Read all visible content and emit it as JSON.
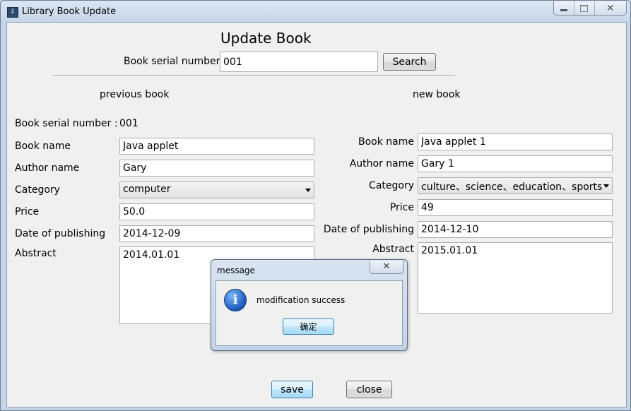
{
  "window": {
    "title": "Library Book Update",
    "app_icon": "book-app-icon",
    "controls": {
      "minimize": "minimize-icon",
      "maximize": "maximize-icon",
      "close": "✕"
    }
  },
  "header": {
    "title": "Update Book",
    "serial_label": "Book serial number",
    "serial_value": "001",
    "search_label": "Search"
  },
  "previous": {
    "heading": "previous book",
    "serial_label": "Book serial number :",
    "serial_value": "001",
    "name_label": "Book name",
    "name_value": "Java applet",
    "author_label": "Author name",
    "author_value": "Gary",
    "category_label": "Category",
    "category_value": "computer",
    "price_label": "Price",
    "price_value": "50.0",
    "date_label": "Date of publishing",
    "date_value": "2014-12-09",
    "abstract_label": "Abstract",
    "abstract_value": "2014.01.01"
  },
  "new": {
    "heading": "new book",
    "name_label": "Book name",
    "name_value": "Java applet 1",
    "author_label": "Author name",
    "author_value": "Gary 1",
    "category_label": "Category",
    "category_value": "culture、science、education、sports",
    "price_label": "Price",
    "price_value": "49",
    "date_label": "Date of publishing",
    "date_value": "2014-12-10",
    "abstract_label": "Abstract",
    "abstract_value": "2015.01.01"
  },
  "footer": {
    "save_label": "save",
    "close_label": "close"
  },
  "dialog": {
    "title": "message",
    "close_glyph": "✕",
    "icon": "info-icon",
    "icon_glyph": "i",
    "message": "modification success",
    "ok_label": "确定"
  },
  "colors": {
    "window_frame": "#c6d5e8",
    "client_bg": "#f0f0f0",
    "default_button": "#bee6fd",
    "info_icon": "#1f5fbf"
  }
}
